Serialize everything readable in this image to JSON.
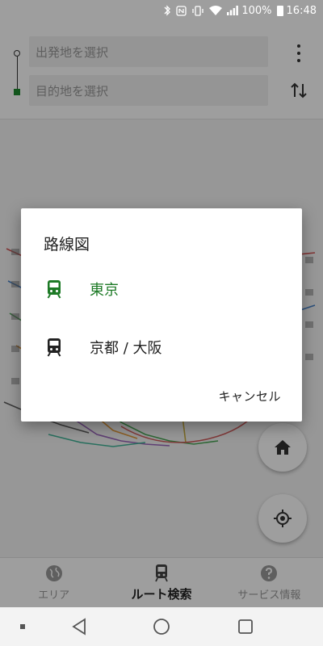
{
  "status_bar": {
    "battery_percent": "100%",
    "time": "16:48"
  },
  "search": {
    "from_placeholder": "出発地を選択",
    "to_placeholder": "目的地を選択"
  },
  "bottom_nav": {
    "items": [
      {
        "label": "エリア",
        "icon": "globe-icon"
      },
      {
        "label": "ルート検索",
        "icon": "train-icon"
      },
      {
        "label": "サービス情報",
        "icon": "help-icon"
      }
    ]
  },
  "dialog": {
    "title": "路線図",
    "options": [
      {
        "label": "東京",
        "icon": "train-icon"
      },
      {
        "label": "京都 / 大阪",
        "icon": "train-icon"
      }
    ],
    "cancel_label": "キャンセル"
  },
  "colors": {
    "accent_green": "#1d7a26",
    "overlay": "rgba(0,0,0,0.38)"
  }
}
